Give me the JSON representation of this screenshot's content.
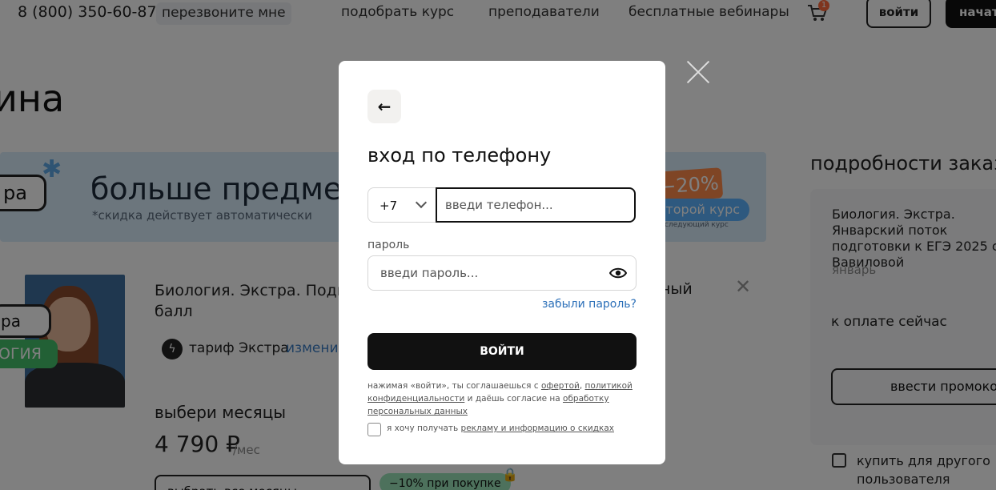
{
  "header": {
    "phone": "8 (800) 350-60-87",
    "callback": "перезвоните мне",
    "nav": [
      "подобрать курс",
      "преподаватели",
      "бесплатные вебинары"
    ],
    "cart_count": "1",
    "login": "войти",
    "start": "начать"
  },
  "page": {
    "title": "ина",
    "banner": {
      "tag": "ра",
      "headline": "больше предметов",
      "sub": "*скидка действует автоматически",
      "discount": "−20%",
      "pill": "второй курс",
      "fine": "следующий курс"
    },
    "course": {
      "sticker1": "ра",
      "sticker2": "ОГИЯ",
      "title": "Биология. Экстра. Подго",
      "title_tail": "ный",
      "title_line2": "балл",
      "tariff": "тариф Экстра",
      "tariff_change": "изменить",
      "months_label": "выбери месяцы",
      "price": "4 790 ₽",
      "per_month": "/мес",
      "all_months": "выбрать все месяцы",
      "discount_pill": "−10% при покупке"
    },
    "order": {
      "title": "подробности заказа",
      "course": "Биология. Экстра. Январский поток подготовки к ЕГЭ 2025 с Вавиловой",
      "month": "январь",
      "pay_now": "к оплате сейчас",
      "promo": "ввести промокод",
      "other_user": "купить для другого пользователя"
    }
  },
  "modal": {
    "title": "вход по телефону",
    "country_code": "+7",
    "phone_placeholder": "введи телефон...",
    "password_label": "пароль",
    "password_placeholder": "введи пароль...",
    "forgot": "забыли пароль?",
    "submit": "ВОЙТИ",
    "legal": {
      "prefix": "нажимая «войти», ты соглашаешься с ",
      "offer": "офертой",
      "comma": ", ",
      "policy": "политикой конфиденциальности",
      "middle": " и даёшь согласие на ",
      "processing": "обработку персональных данных"
    },
    "ads": {
      "prefix": "я хочу получать ",
      "link": "рекламу и информацию о скидках"
    }
  },
  "colors": {
    "overlay": "#000000",
    "accent_link": "#2b6fb8",
    "button": "#111111",
    "banner": "#d9ecfb"
  }
}
